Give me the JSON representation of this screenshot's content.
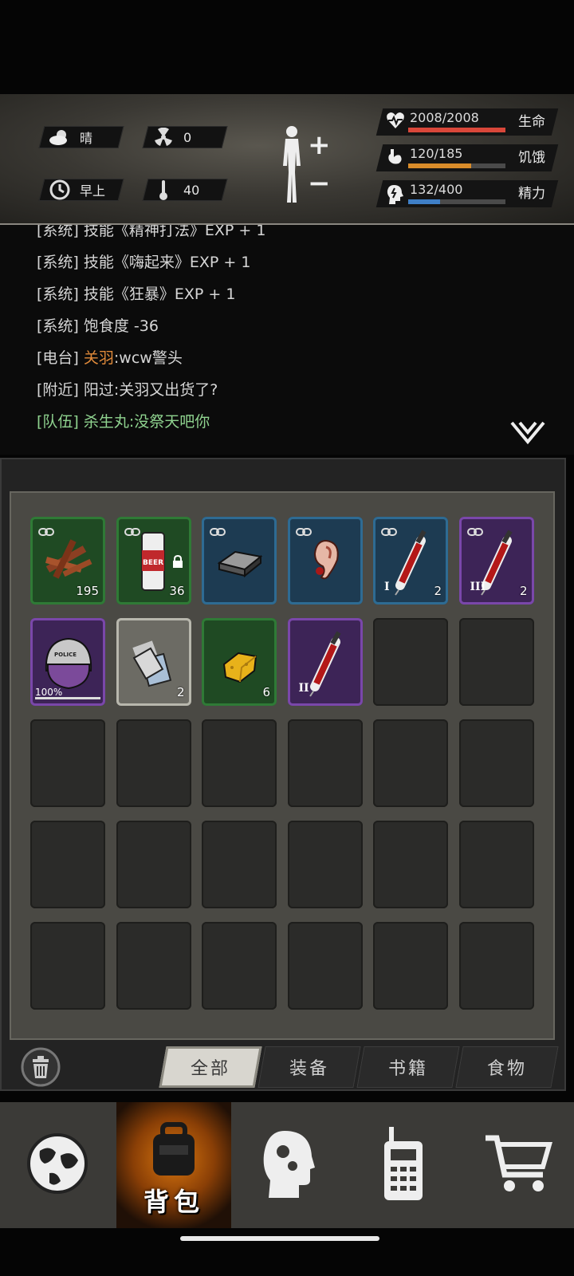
{
  "status": {
    "weather": "晴",
    "radiation": "0",
    "time_of_day": "早上",
    "temperature": "40"
  },
  "stats": [
    {
      "label": "生命",
      "value": "2008/2008",
      "fraction": 1.0,
      "color": "#d9473a",
      "icon": "heart-pulse-icon"
    },
    {
      "label": "饥饿",
      "value": "120/185",
      "fraction": 0.65,
      "color": "#d98c2a",
      "icon": "stomach-icon"
    },
    {
      "label": "精力",
      "value": "132/400",
      "fraction": 0.33,
      "color": "#3f7fc6",
      "icon": "brain-icon"
    }
  ],
  "log": [
    {
      "tag": "[系统]",
      "msg": "技能《精神打法》EXP + 1",
      "color": "#d6d6d6",
      "partial": true
    },
    {
      "tag": "[系统]",
      "msg": "技能《嗨起来》EXP + 1",
      "color": "#d6d6d6"
    },
    {
      "tag": "[系统]",
      "msg": "技能《狂暴》EXP + 1",
      "color": "#d6d6d6"
    },
    {
      "tag": "[系统]",
      "msg": "饱食度 -36",
      "color": "#d6d6d6"
    },
    {
      "tag": "[电台]",
      "name": "关羽",
      "msg": ":wcw警头",
      "color": "#d6d6d6",
      "name_color": "#e08a3a"
    },
    {
      "tag": "[附近]",
      "msg": "阳过:关羽又出货了?",
      "color": "#d6d6d6"
    },
    {
      "tag": "[队伍]",
      "msg": "杀生丸:没祭天吧你",
      "color": "#8fd38f"
    }
  ],
  "inventory": {
    "slots": [
      {
        "rarity": "green",
        "item": "wood-sticks",
        "qty": "195",
        "bound": true
      },
      {
        "rarity": "green",
        "item": "beer-can",
        "qty": "36",
        "bound": true,
        "locked": true,
        "label": "BEER"
      },
      {
        "rarity": "blue",
        "item": "whetstone",
        "bound": true
      },
      {
        "rarity": "blue",
        "item": "severed-ear",
        "bound": true
      },
      {
        "rarity": "blue",
        "item": "syringe",
        "qty": "2",
        "tier": "I",
        "bound": true
      },
      {
        "rarity": "purple",
        "item": "syringe",
        "qty": "2",
        "tier": "III",
        "bound": true
      },
      {
        "rarity": "purple",
        "item": "police-helmet",
        "durability": "100%",
        "label": "POLICE"
      },
      {
        "rarity": "white",
        "item": "paper-sheets",
        "qty": "2"
      },
      {
        "rarity": "green",
        "item": "sponge",
        "qty": "6"
      },
      {
        "rarity": "purple",
        "item": "syringe",
        "tier": "II"
      }
    ],
    "total_slots": 30
  },
  "tabs": [
    "全部",
    "装备",
    "书籍",
    "食物"
  ],
  "active_tab": 0,
  "nav": {
    "items": [
      "world-map",
      "backpack",
      "skills",
      "radio",
      "shop"
    ],
    "active": 1,
    "active_label": "背包"
  }
}
